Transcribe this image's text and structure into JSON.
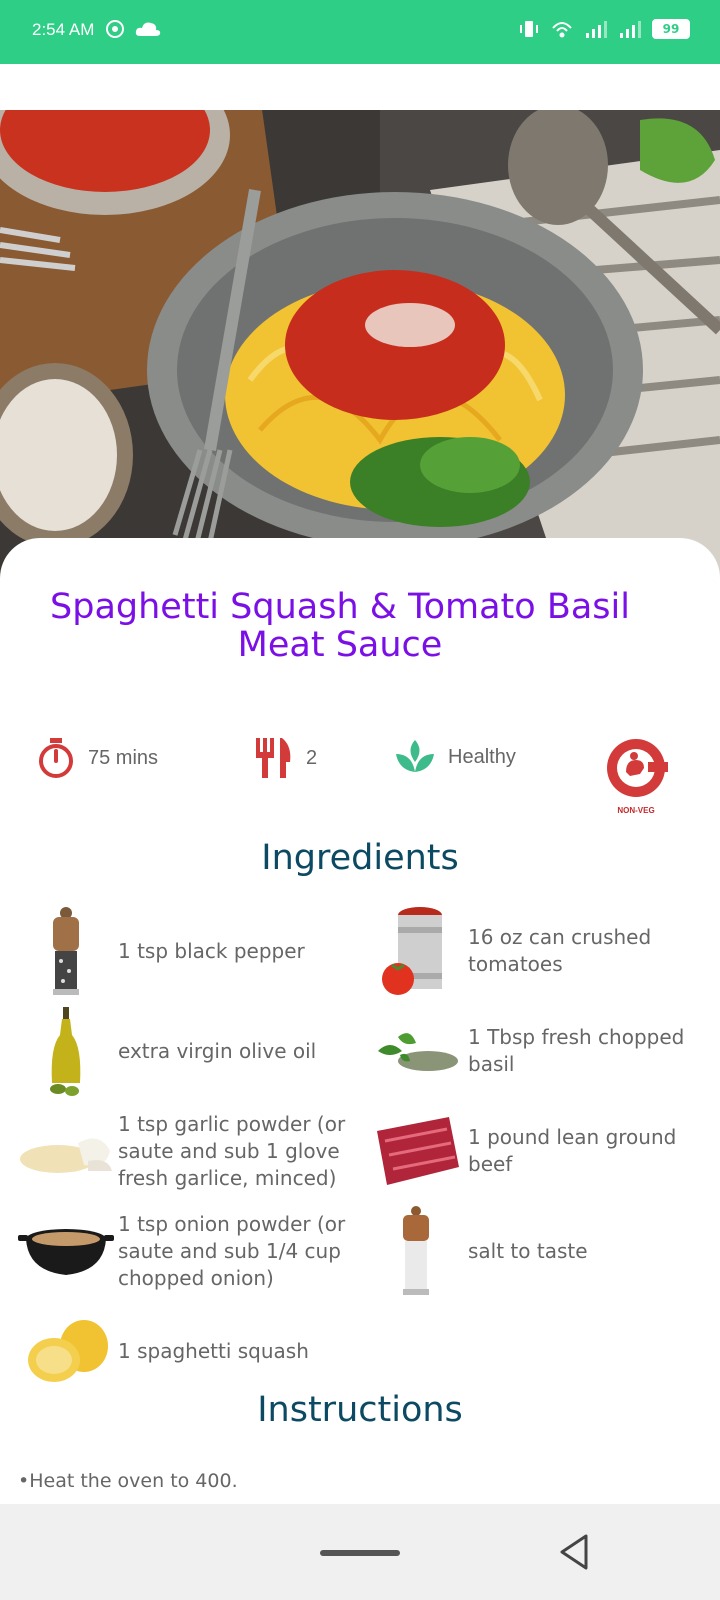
{
  "status_bar": {
    "time": "2:54 AM",
    "battery": "99",
    "color": "#2fce86"
  },
  "recipe": {
    "title": "Spaghetti Squash & Tomato Basil Meat Sauce",
    "time": "75 mins",
    "servings": "2",
    "category": "Healthy",
    "diet_badge": "NON-VEG"
  },
  "ingredients_title": "Ingredients",
  "ingredients": [
    {
      "text": "1 tsp black pepper",
      "icon": "pepper-grinder-icon"
    },
    {
      "text": "16 oz can crushed tomatoes",
      "icon": "tomato-can-icon"
    },
    {
      "text": "extra virgin olive oil",
      "icon": "olive-oil-icon"
    },
    {
      "text": "1 Tbsp fresh chopped basil",
      "icon": "basil-icon"
    },
    {
      "text": "1 tsp garlic powder (or saute and sub 1 glove fresh garlice, minced)",
      "icon": "garlic-powder-icon"
    },
    {
      "text": "1 pound lean ground beef",
      "icon": "ground-beef-icon"
    },
    {
      "text": "1 tsp onion powder (or saute and sub 1/4 cup chopped onion)",
      "icon": "onion-powder-icon"
    },
    {
      "text": "salt to taste",
      "icon": "salt-shaker-icon"
    },
    {
      "text": "1 spaghetti squash",
      "icon": "spaghetti-squash-icon"
    }
  ],
  "instructions_title": "Instructions",
  "instructions": [
    "Heat the oven to 400."
  ],
  "colors": {
    "title": "#7a0fe6",
    "section": "#0c4a63",
    "accent_red": "#d33a3a",
    "accent_green": "#3dbb8a"
  }
}
